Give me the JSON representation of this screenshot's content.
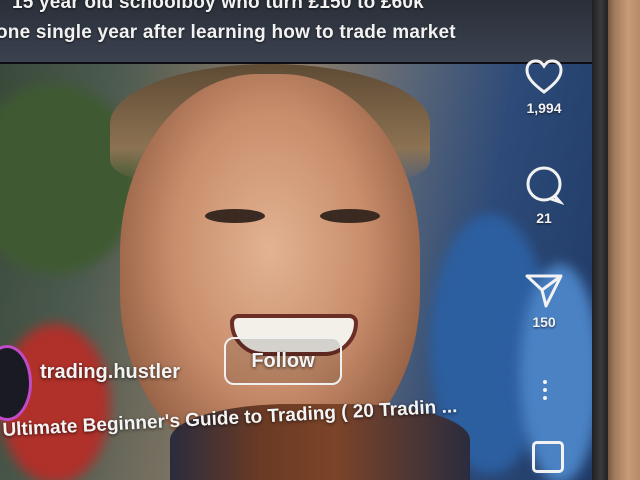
{
  "banner": {
    "line1": "15 year old schoolboy who turn £150 to £60k",
    "line2": "one single year after learning how to trade market"
  },
  "rail": {
    "like_count": "1,994",
    "comment_count": "21",
    "share_count": "150"
  },
  "creator": {
    "username": "trading.hustler",
    "follow_label": "Follow"
  },
  "caption": "Ultimate Beginner's Guide to Trading ( 20 Tradin ...",
  "icons": [
    "heart-icon",
    "comment-icon",
    "share-icon",
    "more-icon",
    "audio-thumbnail-icon"
  ],
  "colors": {
    "text": "#f2f2f2",
    "avatar_ring": "#c04ac8"
  }
}
